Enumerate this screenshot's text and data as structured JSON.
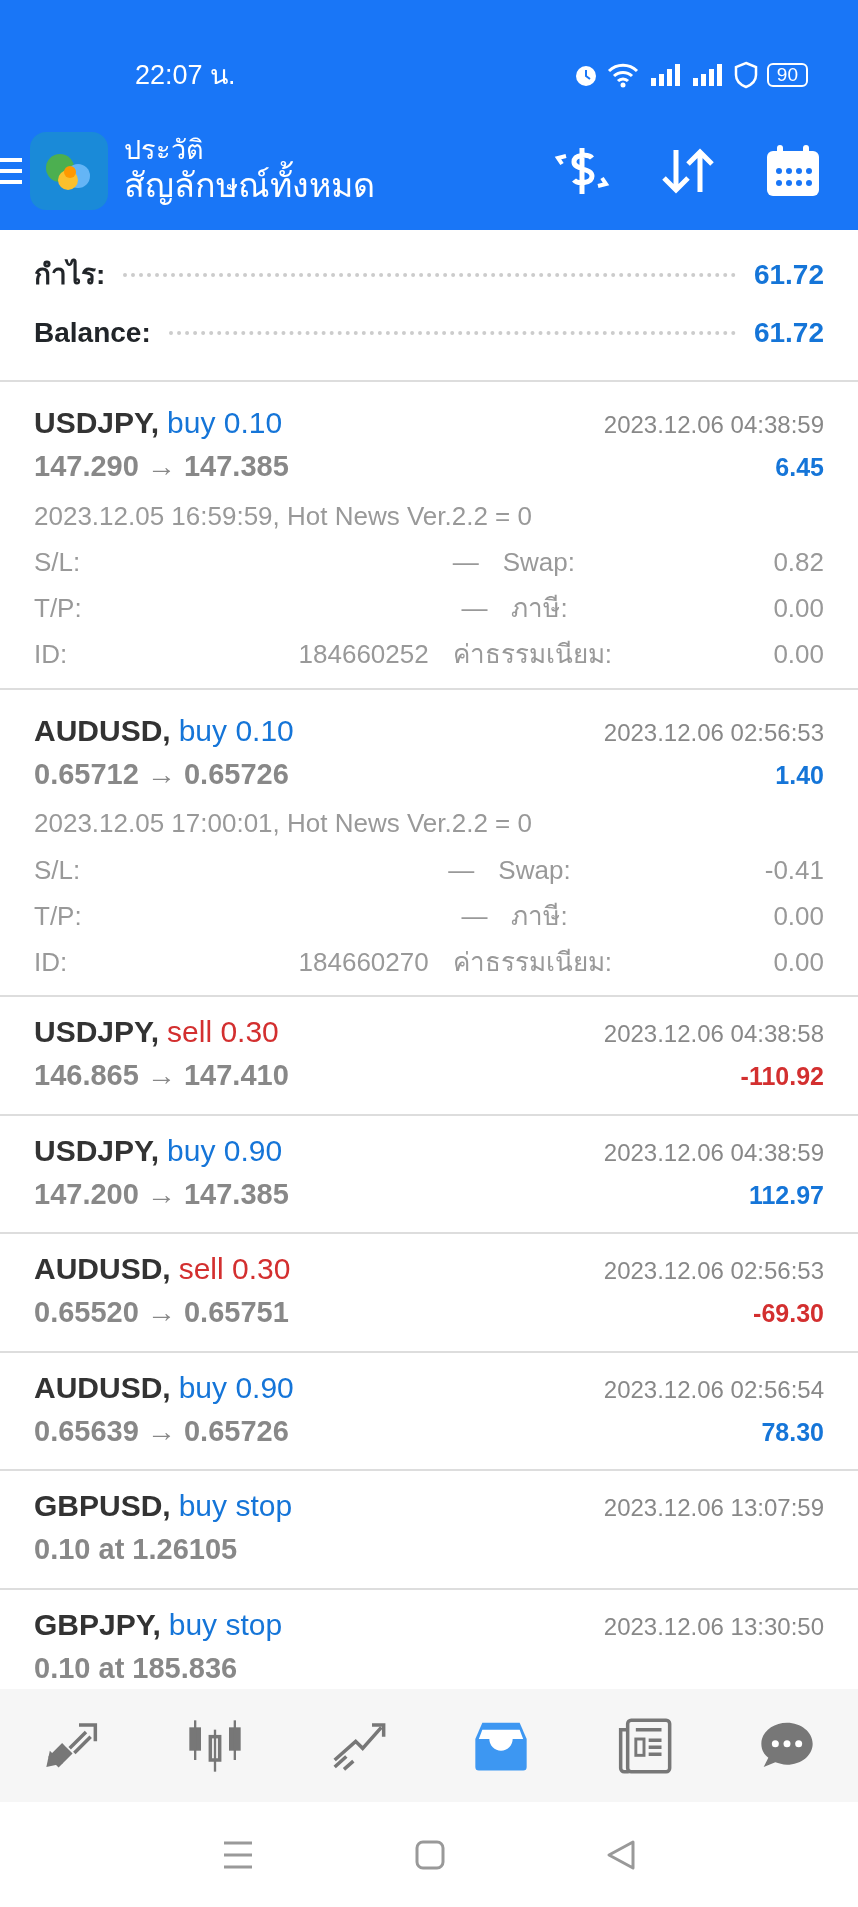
{
  "status_bar": {
    "time": "22:07 น.",
    "battery": "90"
  },
  "header": {
    "title": "ประวัติ",
    "subtitle": "สัญลักษณ์ทั้งหมด"
  },
  "summary": [
    {
      "label": "กำไร:",
      "value": "61.72"
    },
    {
      "label": "Balance:",
      "value": "61.72"
    }
  ],
  "trades": [
    {
      "symbol": "USDJPY,",
      "order": "buy 0.10",
      "kind": "buy",
      "time": "2023.12.06 04:38:59",
      "prices": "147.290 → 147.385",
      "profit": "6.45",
      "loss": false,
      "expanded": true,
      "comment": "2023.12.05 16:59:59, Hot News Ver.2.2 = 0",
      "details": [
        {
          "label": "S/L:",
          "value": "—",
          "label2": "Swap:",
          "value2": "0.82"
        },
        {
          "label": "T/P:",
          "value": "—",
          "label2": "ภาษี:",
          "value2": "0.00"
        },
        {
          "label": "ID:",
          "value": "184660252",
          "label2": "ค่าธรรมเนียม:",
          "value2": "0.00"
        }
      ]
    },
    {
      "symbol": "AUDUSD,",
      "order": "buy 0.10",
      "kind": "buy",
      "time": "2023.12.06 02:56:53",
      "prices": "0.65712 → 0.65726",
      "profit": "1.40",
      "loss": false,
      "expanded": true,
      "comment": "2023.12.05 17:00:01, Hot News Ver.2.2 = 0",
      "details": [
        {
          "label": "S/L:",
          "value": "—",
          "label2": "Swap:",
          "value2": "-0.41"
        },
        {
          "label": "T/P:",
          "value": "—",
          "label2": "ภาษี:",
          "value2": "0.00"
        },
        {
          "label": "ID:",
          "value": "184660270",
          "label2": "ค่าธรรมเนียม:",
          "value2": "0.00"
        }
      ]
    },
    {
      "symbol": "USDJPY,",
      "order": "sell 0.30",
      "kind": "sell",
      "time": "2023.12.06 04:38:58",
      "prices": "146.865 → 147.410",
      "profit": "-110.92",
      "loss": true,
      "expanded": false
    },
    {
      "symbol": "USDJPY,",
      "order": "buy 0.90",
      "kind": "buy",
      "time": "2023.12.06 04:38:59",
      "prices": "147.200 → 147.385",
      "profit": "112.97",
      "loss": false,
      "expanded": false
    },
    {
      "symbol": "AUDUSD,",
      "order": "sell 0.30",
      "kind": "sell",
      "time": "2023.12.06 02:56:53",
      "prices": "0.65520 → 0.65751",
      "profit": "-69.30",
      "loss": true,
      "expanded": false
    },
    {
      "symbol": "AUDUSD,",
      "order": "buy 0.90",
      "kind": "buy",
      "time": "2023.12.06 02:56:54",
      "prices": "0.65639 → 0.65726",
      "profit": "78.30",
      "loss": false,
      "expanded": false
    },
    {
      "symbol": "GBPUSD,",
      "order": "buy stop",
      "kind": "buy",
      "time": "2023.12.06 13:07:59",
      "prices": "0.10 at 1.26105",
      "expanded": false
    },
    {
      "symbol": "GBPJPY,",
      "order": "buy stop",
      "kind": "buy",
      "time": "2023.12.06 13:30:50",
      "prices": "0.10 at 185.836",
      "expanded": false
    }
  ],
  "tabs": [
    {
      "kind": "trade",
      "selected": false
    },
    {
      "kind": "chart",
      "selected": false
    },
    {
      "kind": "signals",
      "selected": false
    },
    {
      "kind": "history",
      "selected": true
    },
    {
      "kind": "news",
      "selected": false
    },
    {
      "kind": "chat",
      "selected": false
    }
  ]
}
